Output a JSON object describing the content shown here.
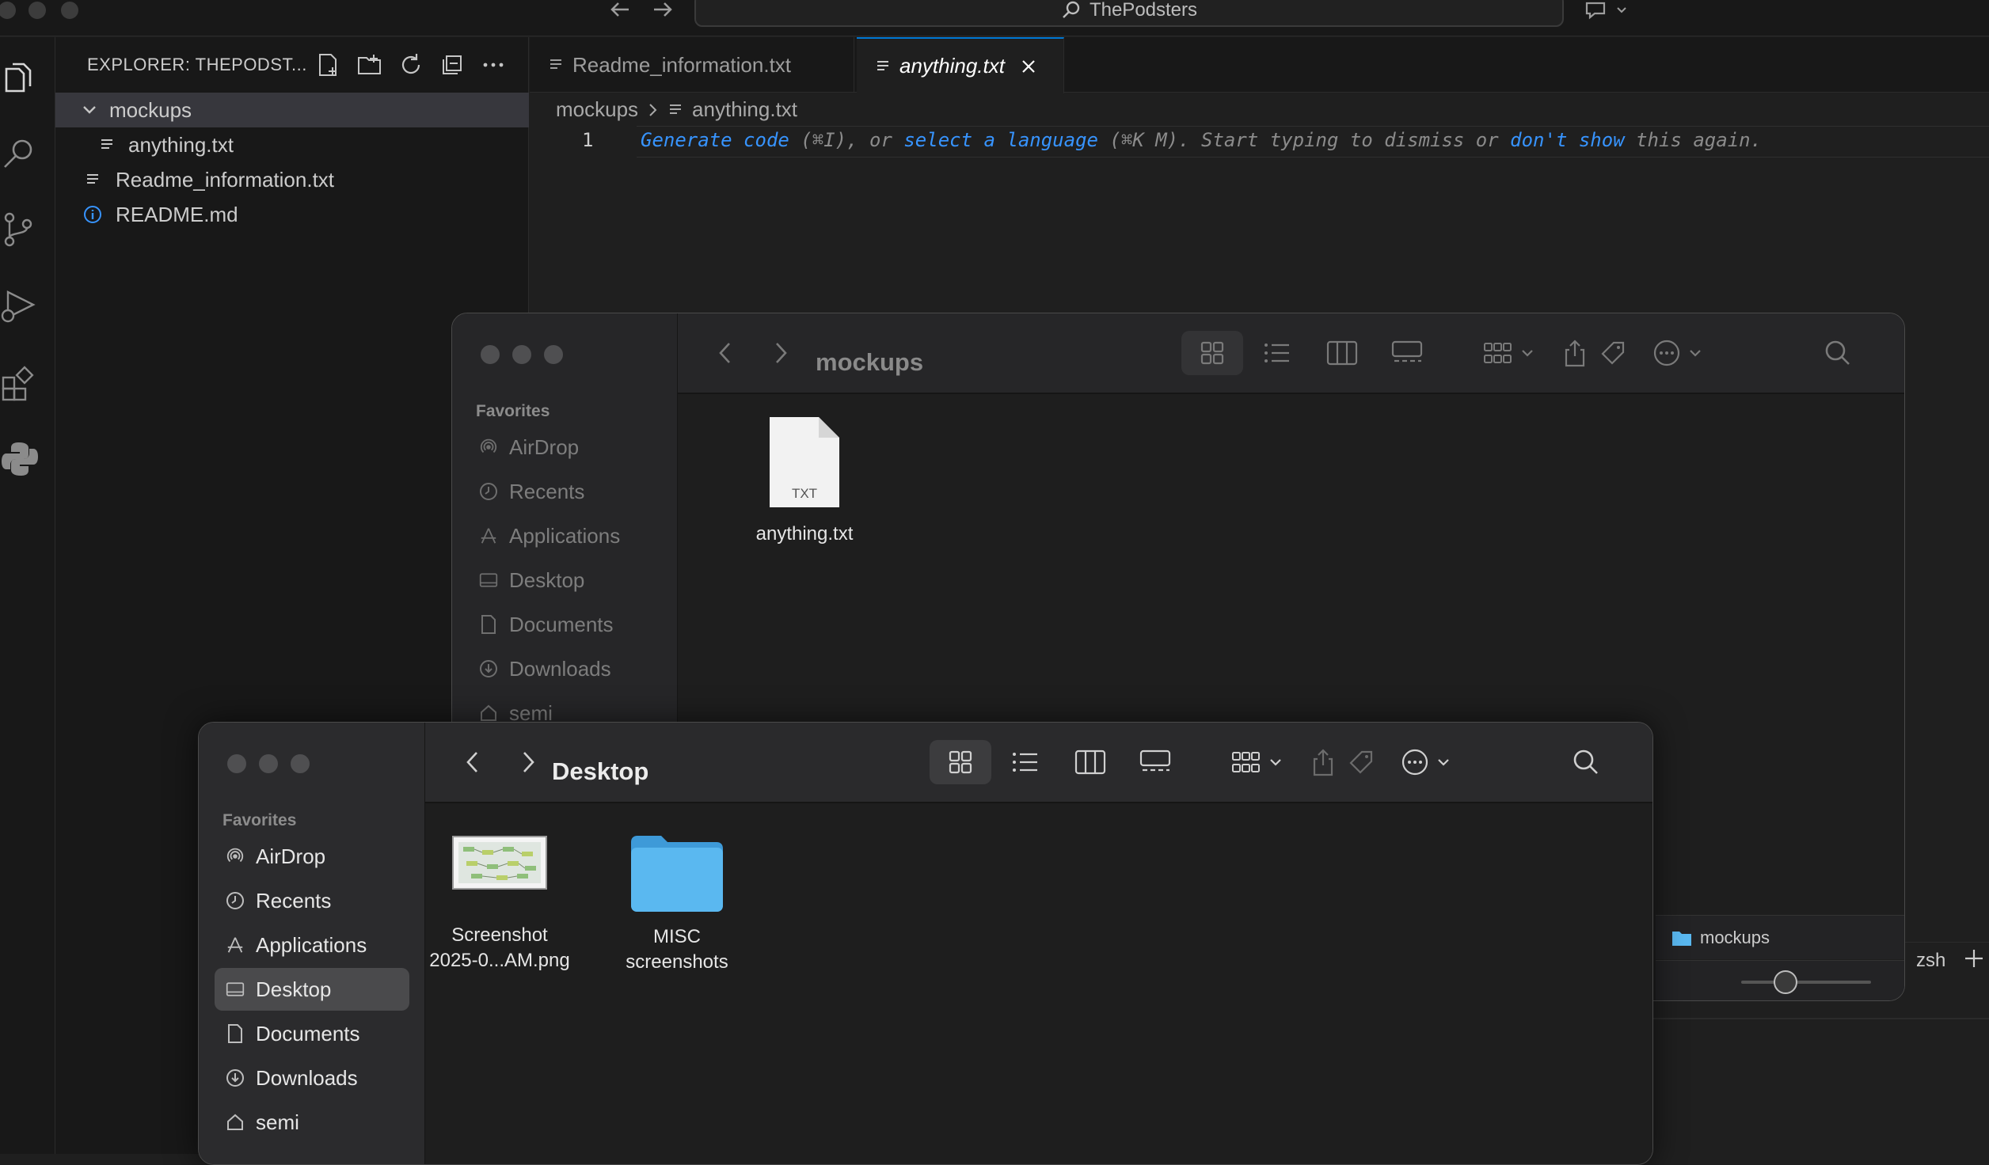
{
  "titlebar": {
    "search_text": "ThePodsters"
  },
  "activity_bar": {
    "items": [
      "explorer-icon",
      "search-icon",
      "source-control-icon",
      "run-debug-icon",
      "extensions-icon",
      "python-icon"
    ]
  },
  "explorer": {
    "title": "EXPLORER: THEPODST...",
    "tree": [
      {
        "label": "mockups",
        "type": "folder"
      },
      {
        "label": "anything.txt",
        "type": "file"
      },
      {
        "label": "Readme_information.txt",
        "type": "file"
      },
      {
        "label": "README.md",
        "type": "info-file"
      }
    ]
  },
  "editor": {
    "tabs": [
      {
        "label": "Readme_information.txt",
        "active": false
      },
      {
        "label": "anything.txt",
        "active": true
      }
    ],
    "breadcrumb": {
      "folder": "mockups",
      "file": "anything.txt"
    },
    "line_number": "1",
    "hint": {
      "link1": "Generate code",
      "text1": " (⌘I), or ",
      "link2": "select a language",
      "text2": " (⌘K M). Start typing to dismiss or ",
      "link3": "don't show",
      "text3": " this again."
    }
  },
  "finder_back": {
    "title": "mockups",
    "favorites_header": "Favorites",
    "sidebar": [
      "AirDrop",
      "Recents",
      "Applications",
      "Desktop",
      "Documents",
      "Downloads",
      "semi"
    ],
    "files": [
      {
        "name": "anything.txt",
        "badge": "TXT"
      }
    ],
    "path_bar": "mockups"
  },
  "finder_front": {
    "title": "Desktop",
    "favorites_header": "Favorites",
    "sidebar": [
      "AirDrop",
      "Recents",
      "Applications",
      "Desktop",
      "Documents",
      "Downloads",
      "semi"
    ],
    "selected_sidebar": "Desktop",
    "files": [
      {
        "name_line1": "Screenshot",
        "name_line2": "2025-0...AM.png"
      },
      {
        "name_line1": "MISC screenshots",
        "name_line2": ""
      }
    ]
  },
  "terminal": {
    "tab_label": "zsh"
  },
  "colors": {
    "accent": "#0078d4",
    "link": "#3794ff",
    "folder_blue": "#5ab8f0"
  }
}
